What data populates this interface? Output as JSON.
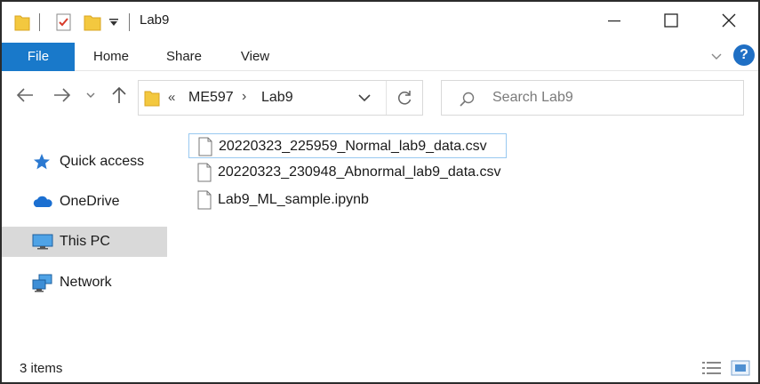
{
  "window": {
    "title": "Lab9",
    "icons": {
      "folder": "folder-icon",
      "properties": "properties-checkmark-icon",
      "new_folder": "new-folder-icon",
      "customize": "dropdown-arrow-icon",
      "minimize": "minimize-icon",
      "maximize": "maximize-icon",
      "close": "close-icon"
    }
  },
  "ribbon": {
    "tabs": [
      {
        "label": "File",
        "active": true
      },
      {
        "label": "Home"
      },
      {
        "label": "Share"
      },
      {
        "label": "View"
      }
    ],
    "help_label": "?",
    "accent_color": "#1979ca"
  },
  "navigation": {
    "address": {
      "overflow": "«",
      "breadcrumbs": [
        "ME597",
        "Lab9"
      ],
      "separator": "›"
    },
    "search": {
      "placeholder": "Search Lab9"
    }
  },
  "sidebar": {
    "items": [
      {
        "label": "Quick access",
        "icon": "star-icon"
      },
      {
        "label": "OneDrive",
        "icon": "cloud-icon"
      },
      {
        "label": "This PC",
        "icon": "monitor-icon",
        "selected": true
      },
      {
        "label": "Network",
        "icon": "network-icon"
      }
    ]
  },
  "files": [
    {
      "name": "20220323_225959_Normal_lab9_data.csv",
      "focused": true
    },
    {
      "name": "20220323_230948_Abnormal_lab9_data.csv"
    },
    {
      "name": "Lab9_ML_sample.ipynb"
    }
  ],
  "status_bar": {
    "item_count": "3 items"
  }
}
